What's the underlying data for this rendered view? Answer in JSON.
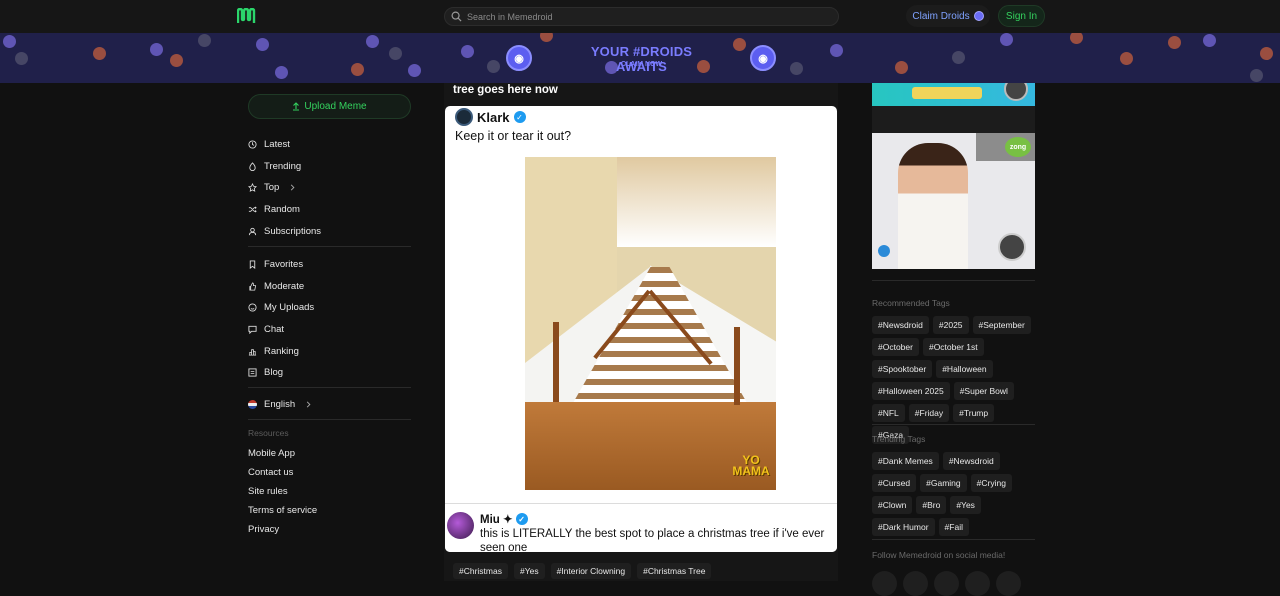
{
  "nav": {
    "search_placeholder": "Search in Memedroid",
    "claim_label": "Claim Droids",
    "signin_label": "Sign In"
  },
  "banner": {
    "title": "YOUR #DROIDS AWAITS",
    "subtitle": "CLAIM NOW"
  },
  "sidebar": {
    "upload_label": "Upload Meme",
    "primary": [
      {
        "label": "Latest",
        "icon": "clock-icon"
      },
      {
        "label": "Trending",
        "icon": "flame-icon"
      },
      {
        "label": "Top",
        "icon": "star-icon"
      },
      {
        "label": "Random",
        "icon": "shuffle-icon"
      },
      {
        "label": "Subscriptions",
        "icon": "user-icon"
      }
    ],
    "secondary": [
      {
        "label": "Favorites",
        "icon": "bookmark-icon"
      },
      {
        "label": "Moderate",
        "icon": "thumbs-icon"
      },
      {
        "label": "My Uploads",
        "icon": "smile-icon"
      },
      {
        "label": "Chat",
        "icon": "chat-icon"
      },
      {
        "label": "Ranking",
        "icon": "ranking-icon"
      },
      {
        "label": "Blog",
        "icon": "blog-icon"
      }
    ],
    "language": "English",
    "resources_label": "Resources",
    "resources": [
      "Mobile App",
      "Contact us",
      "Site rules",
      "Terms of service",
      "Privacy"
    ]
  },
  "post": {
    "title": "tree goes here now",
    "tweet_author": "Klark",
    "tweet_text": "Keep it or tear it out?",
    "watermark": "YO MAMA",
    "reply_author": "Miu ✦",
    "reply_text": "this is LITERALLY the best spot to place a christmas tree if i've ever seen one",
    "tags": [
      "#Christmas",
      "#Yes",
      "#Interior Clowning",
      "#Christmas Tree"
    ]
  },
  "right": {
    "ad_brand": "zong",
    "recommended_label": "Recommended Tags",
    "recommended_tags": [
      "#Newsdroid",
      "#2025",
      "#September",
      "#October",
      "#October 1st",
      "#Spooktober",
      "#Halloween",
      "#Halloween 2025",
      "#Super Bowl",
      "#NFL",
      "#Friday",
      "#Trump",
      "#Gaza"
    ],
    "trending_label": "Trending Tags",
    "trending_tags": [
      "#Dank Memes",
      "#Newsdroid",
      "#Cursed",
      "#Gaming",
      "#Crying",
      "#Clown",
      "#Bro",
      "#Yes",
      "#Dark Humor",
      "#Fail"
    ],
    "social_label": "Follow Memedroid on social media!"
  },
  "colors": {
    "accent_green": "#34d15e",
    "droid_blue": "#7a7cff",
    "background": "#111111"
  }
}
